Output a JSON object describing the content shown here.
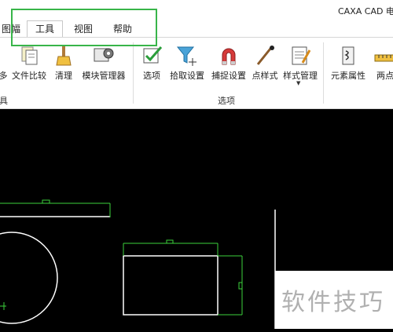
{
  "app": {
    "title": "CAXA CAD 电"
  },
  "tabs": [
    {
      "label": "图幅",
      "active": false
    },
    {
      "label": "工具",
      "active": true
    },
    {
      "label": "视图",
      "active": false
    },
    {
      "label": "帮助",
      "active": false
    }
  ],
  "ribbon": {
    "tools": [
      {
        "label": "多",
        "icon": "tool-icon"
      },
      {
        "label": "文件比较",
        "icon": "file-compare-icon"
      },
      {
        "label": "清理",
        "icon": "clean-icon"
      },
      {
        "label": "模块管理器",
        "icon": "module-manager-icon"
      },
      {
        "label": "选项",
        "icon": "options-check-icon"
      },
      {
        "label": "拾取设置",
        "icon": "pick-filter-icon"
      },
      {
        "label": "捕捉设置",
        "icon": "snap-magnet-icon"
      },
      {
        "label": "点样式",
        "icon": "point-style-icon"
      },
      {
        "label": "样式管理",
        "icon": "style-manager-icon"
      },
      {
        "label": "元素属性",
        "icon": "element-property-icon"
      },
      {
        "label": "两点",
        "icon": "ruler-icon"
      }
    ],
    "groups": {
      "tools_group": "具",
      "options_group": "选项"
    }
  },
  "watermark": "软件技巧",
  "colors": {
    "highlight": "#38b549",
    "canvas": "#000000",
    "drawing": "#ffffff",
    "dimension": "#3cd23c"
  }
}
